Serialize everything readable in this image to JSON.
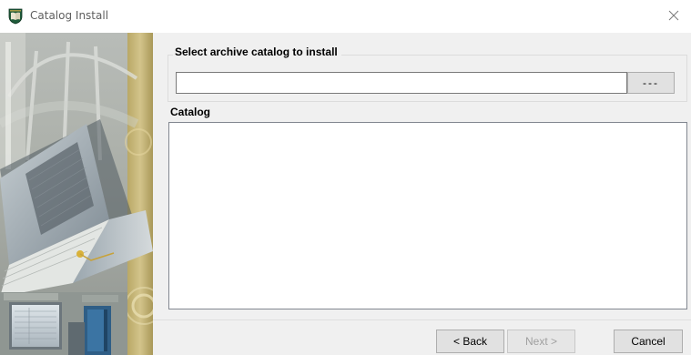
{
  "window": {
    "title": "Catalog Install",
    "close_symbol": "×"
  },
  "icons": {
    "app": "shield-book-icon",
    "close": "close-icon"
  },
  "archive_group": {
    "title": "Select archive catalog to install",
    "path_value": "",
    "browse_label": "---"
  },
  "catalog_group": {
    "title": "Catalog",
    "items": []
  },
  "buttons": {
    "back_label": "< Back",
    "next_label": "Next >",
    "cancel_label": "Cancel"
  },
  "colors": {
    "content_bg": "#f0f0f0",
    "panel_gold": "#c9b878",
    "book_steel": "#8e99a3"
  }
}
